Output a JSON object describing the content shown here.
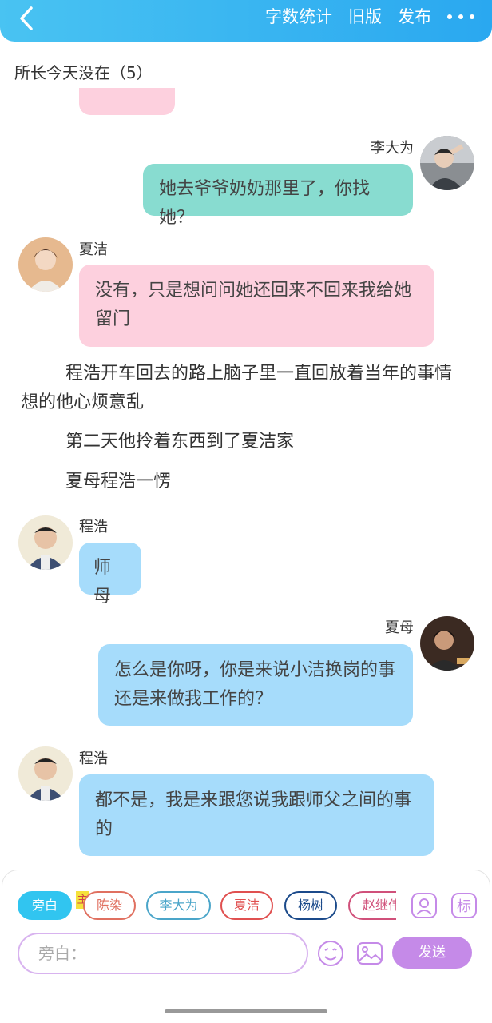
{
  "topbar": {
    "word_count_label": "字数统计",
    "old_version_label": "旧版",
    "publish_label": "发布"
  },
  "chapter": {
    "title": "所长今天没在（5）"
  },
  "messages": [
    {
      "speaker": "李大为",
      "text": "她去爷爷奶奶那里了，你找她？"
    },
    {
      "speaker": "夏洁",
      "text": "没有，只是想问问她还回来不回来我给她留门"
    },
    {
      "speaker": "程浩",
      "text": "师母"
    },
    {
      "speaker": "夏母",
      "text": "怎么是你呀，你是来说小洁换岗的事还是来做我工作的？"
    },
    {
      "speaker": "程浩",
      "text": "都不是，我是来跟您说我跟师父之间的事的"
    }
  ],
  "narrations": [
    "程浩开车回去的路上脑子里一直回放着当年的事情想的他心烦意乱",
    "第二天他拎着东西到了夏洁家",
    "夏母程浩一愣"
  ],
  "roles": [
    {
      "label": "旁白",
      "color": "#31c5f0",
      "active": true
    },
    {
      "label": "陈染",
      "color": "#e07060"
    },
    {
      "label": "李大为",
      "color": "#4aa5c9"
    },
    {
      "label": "夏洁",
      "color": "#e05050"
    },
    {
      "label": "杨树",
      "color": "#1b4a8a"
    },
    {
      "label": "赵继伟",
      "color": "#d0507a"
    }
  ],
  "host_badge": "主",
  "tag_icon_label": "标",
  "composer": {
    "placeholder": "旁白：",
    "send_label": "发送"
  },
  "colors": {
    "accent": "#31c5f0",
    "pink_bubble": "#fdd0de",
    "teal_bubble": "#88dcd0",
    "blue_bubble": "#a6dcfb",
    "send": "#c58ae8"
  }
}
